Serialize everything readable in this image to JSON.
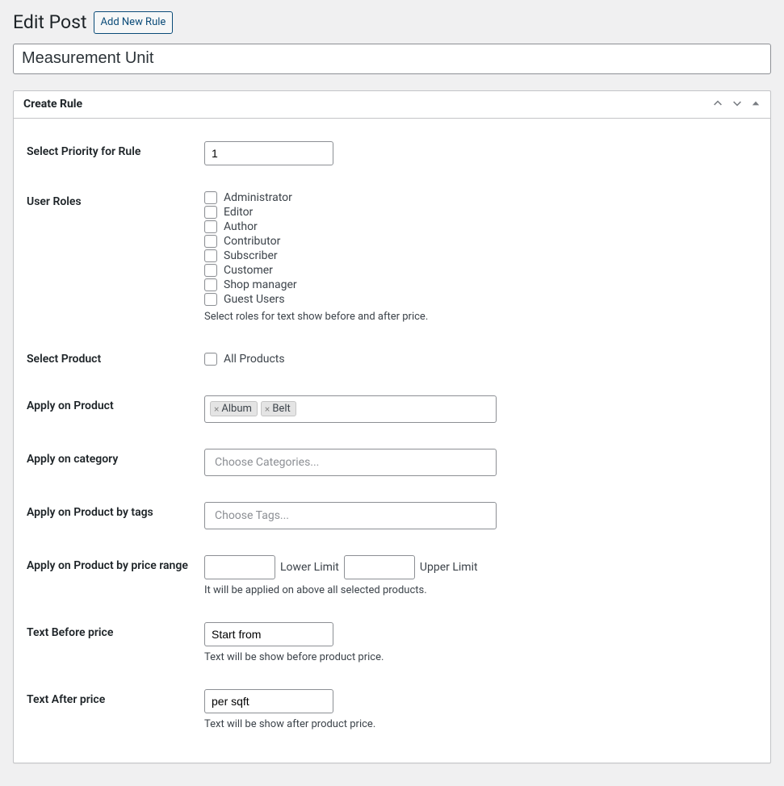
{
  "header": {
    "title": "Edit Post",
    "add_button": "Add New Rule"
  },
  "post_title_value": "Measurement Unit",
  "panel_title": "Create Rule",
  "fields": {
    "priority": {
      "label": "Select Priority for Rule",
      "value": "1"
    },
    "user_roles": {
      "label": "User Roles",
      "options": [
        "Administrator",
        "Editor",
        "Author",
        "Contributor",
        "Subscriber",
        "Customer",
        "Shop manager",
        "Guest Users"
      ],
      "description": "Select roles for text show before and after price."
    },
    "select_product": {
      "label": "Select Product",
      "all_products_label": "All Products"
    },
    "apply_product": {
      "label": "Apply on Product",
      "tags": [
        "Album",
        "Belt"
      ]
    },
    "apply_category": {
      "label": "Apply on category",
      "placeholder": "Choose Categories..."
    },
    "apply_tags": {
      "label": "Apply on Product by tags",
      "placeholder": "Choose Tags..."
    },
    "apply_price_range": {
      "label": "Apply on Product by price range",
      "lower_label": "Lower Limit",
      "upper_label": "Upper Limit",
      "description": "It will be applied on above all selected products."
    },
    "text_before": {
      "label": "Text Before price",
      "value": "Start from",
      "description": "Text will be show before product price."
    },
    "text_after": {
      "label": "Text After price",
      "value": "per sqft",
      "description": "Text will be show after product price."
    }
  }
}
